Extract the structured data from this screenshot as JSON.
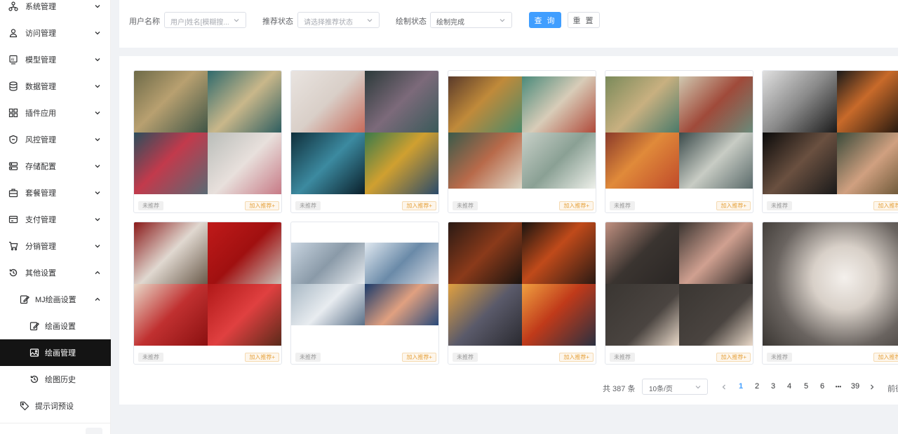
{
  "sidebar": {
    "items": [
      {
        "label": "系统管理",
        "icon": "cluster-icon"
      },
      {
        "label": "访问管理",
        "icon": "user-icon"
      },
      {
        "label": "模型管理",
        "icon": "ai-model-icon"
      },
      {
        "label": "数据管理",
        "icon": "database-icon"
      },
      {
        "label": "插件应用",
        "icon": "grid-icon"
      },
      {
        "label": "风控管理",
        "icon": "shield-icon"
      },
      {
        "label": "存储配置",
        "icon": "storage-icon"
      },
      {
        "label": "套餐管理",
        "icon": "package-icon"
      },
      {
        "label": "支付管理",
        "icon": "wallet-icon"
      },
      {
        "label": "分销管理",
        "icon": "cart-icon"
      },
      {
        "label": "其他设置",
        "icon": "history-icon"
      }
    ],
    "sub_group": {
      "label": "MJ绘画设置",
      "icon": "edit-icon"
    },
    "sub_items": [
      {
        "label": "绘画设置",
        "icon": "edit-icon"
      },
      {
        "label": "绘画管理",
        "icon": "image-icon"
      },
      {
        "label": "绘图历史",
        "icon": "history-icon"
      }
    ],
    "extra_item": {
      "label": "提示词预设",
      "icon": "tag-icon"
    }
  },
  "search": {
    "user_label": "用户名称",
    "user_placeholder": "用户|姓名[模糊搜...",
    "recommend_label": "推荐状态",
    "recommend_placeholder": "请选择推荐状态",
    "draw_label": "绘制状态",
    "draw_value": "绘制完成",
    "query_button": "查 询",
    "reset_button": "重 置"
  },
  "cards": {
    "tag_left": "未推荐",
    "tag_right": "加入推荐+"
  },
  "pagination": {
    "total": "共 387 条",
    "page_size": "10条/页",
    "pages": [
      "1",
      "2",
      "3",
      "4",
      "5",
      "6"
    ],
    "ellipsis": "•••",
    "last_page": "39",
    "goto": "前往"
  },
  "colors": {
    "primary": "#409eff",
    "sidebar_active": "#141414",
    "recommend_tag": "#e6a23c"
  }
}
